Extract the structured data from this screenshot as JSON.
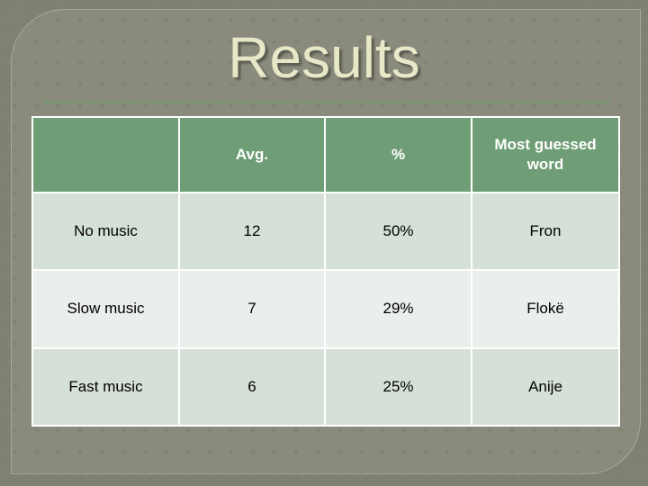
{
  "slide": {
    "title": "Results"
  },
  "table": {
    "headers": [
      "",
      "Avg.",
      "%",
      "Most guessed word"
    ],
    "rows": [
      {
        "condition": "No music",
        "avg": "12",
        "percent": "50%",
        "word": "Fron"
      },
      {
        "condition": "Slow music",
        "avg": "7",
        "percent": "29%",
        "word": "Flokë"
      },
      {
        "condition": "Fast music",
        "avg": "6",
        "percent": "25%",
        "word": "Anije"
      }
    ]
  },
  "colors": {
    "background": "#7f8174",
    "panel": "#8a8b7c",
    "title_text": "#e6e8c8",
    "header_fill": "#6f9e76",
    "row_dark": "#d5e0d7",
    "row_light": "#ebefec",
    "rule": "#7c9474"
  }
}
